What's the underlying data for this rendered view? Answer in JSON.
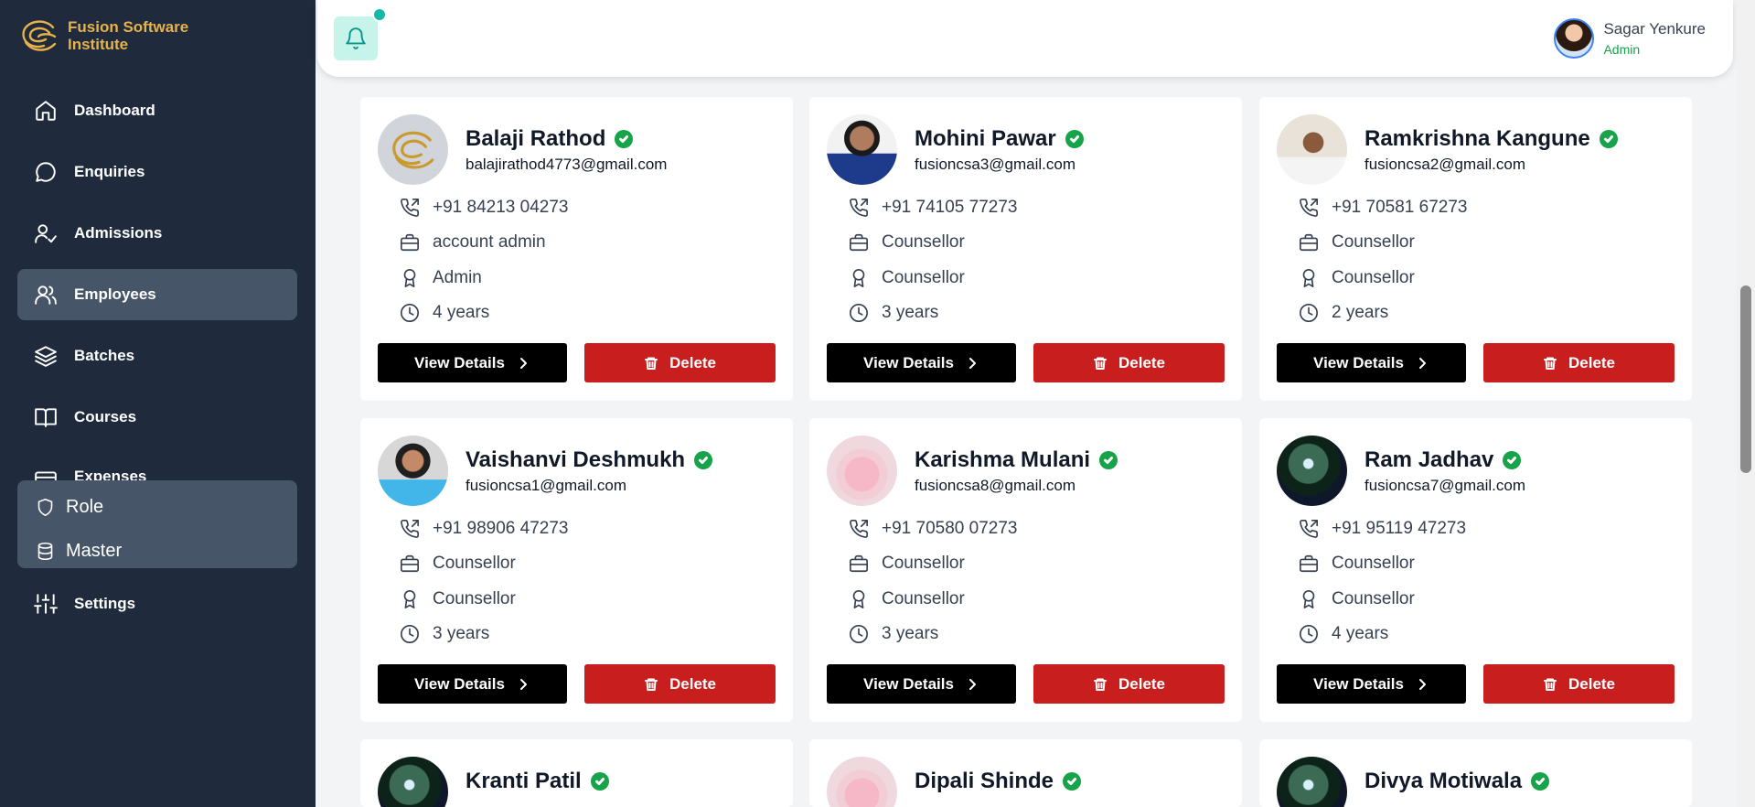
{
  "brand": {
    "line1": "Fusion Software",
    "line2": "Institute",
    "color": "#e7b24a"
  },
  "sidebar": {
    "items": [
      {
        "label": "Dashboard",
        "icon": "home-icon"
      },
      {
        "label": "Enquiries",
        "icon": "chat-icon"
      },
      {
        "label": "Admissions",
        "icon": "user-check-icon"
      },
      {
        "label": "Employees",
        "icon": "users-icon",
        "active": true
      },
      {
        "label": "Batches",
        "icon": "layers-icon"
      },
      {
        "label": "Courses",
        "icon": "book-icon"
      },
      {
        "label": "Expenses",
        "icon": "wallet-icon"
      }
    ],
    "submenu": [
      {
        "label": "Role",
        "icon": "shield-icon"
      },
      {
        "label": "Master",
        "icon": "database-icon"
      }
    ],
    "settings": {
      "label": "Settings",
      "icon": "sliders-icon"
    }
  },
  "header": {
    "user": {
      "name": "Sagar Yenkure",
      "role": "Admin"
    }
  },
  "cards": [
    {
      "name": "Balaji Rathod",
      "email": "balajirathod4773@gmail.com",
      "phone": "+91 84213 04273",
      "designation": "account admin",
      "role": "Admin",
      "experience": "4 years"
    },
    {
      "name": "Mohini Pawar",
      "email": "fusioncsa3@gmail.com",
      "phone": "+91 74105 77273",
      "designation": "Counsellor",
      "role": "Counsellor",
      "experience": "3 years"
    },
    {
      "name": "Ramkrishna Kangune",
      "email": "fusioncsa2@gmail.com",
      "phone": "+91 70581 67273",
      "designation": "Counsellor",
      "role": "Counsellor",
      "experience": "2 years"
    },
    {
      "name": "Vaishanvi Deshmukh",
      "email": "fusioncsa1@gmail.com",
      "phone": "+91 98906 47273",
      "designation": "Counsellor",
      "role": "Counsellor",
      "experience": "3 years"
    },
    {
      "name": "Karishma Mulani",
      "email": "fusioncsa8@gmail.com",
      "phone": "+91 70580 07273",
      "designation": "Counsellor",
      "role": "Counsellor",
      "experience": "3 years"
    },
    {
      "name": "Ram Jadhav",
      "email": "fusioncsa7@gmail.com",
      "phone": "+91 95119 47273",
      "designation": "Counsellor",
      "role": "Counsellor",
      "experience": "4 years"
    },
    {
      "name": "Kranti Patil"
    },
    {
      "name": "Dipali Shinde"
    },
    {
      "name": "Divya Motiwala"
    }
  ],
  "buttons": {
    "view": "View Details",
    "delete": "Delete"
  },
  "colors": {
    "sidebar": "#1f2a3d",
    "active": "#475569",
    "delete": "#c81e1e",
    "verified": "#16a34a",
    "bell_bg": "#c7f4ea"
  }
}
